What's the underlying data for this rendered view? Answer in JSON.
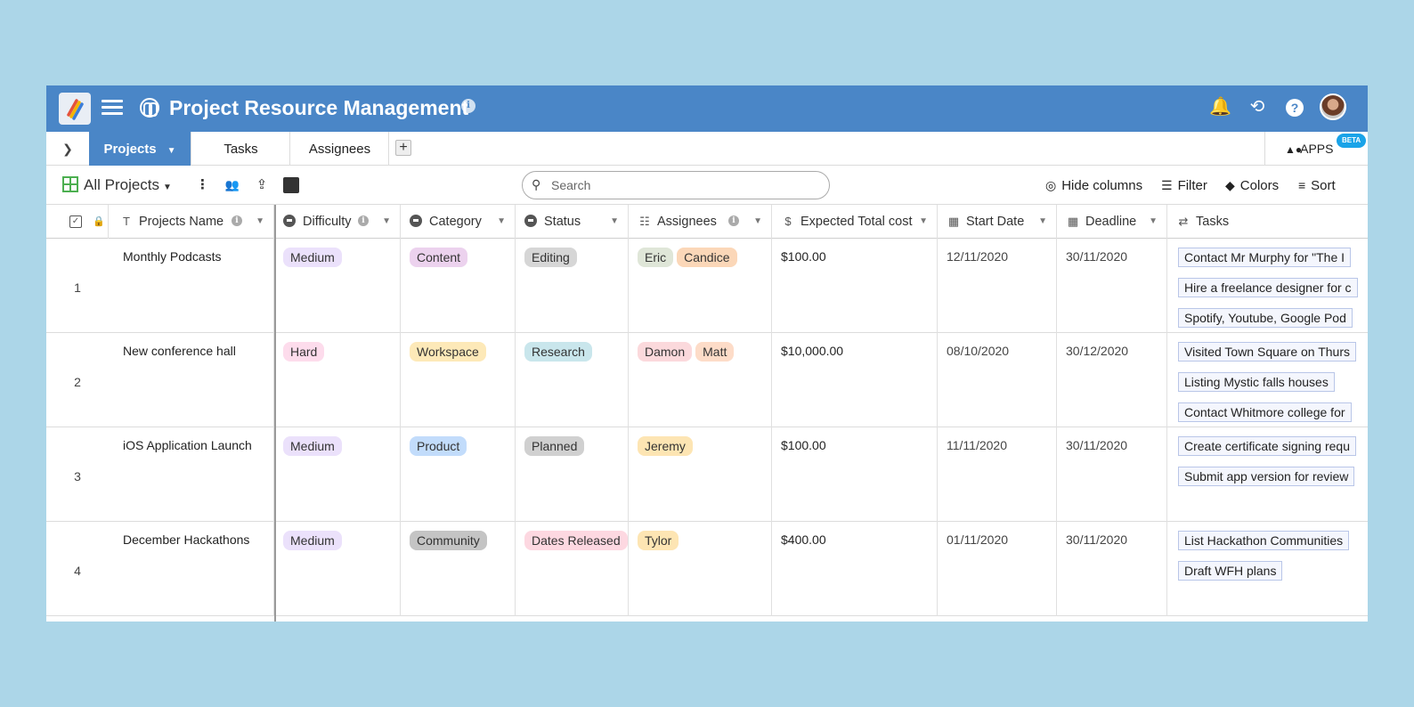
{
  "app": {
    "title": "Project Resource Management",
    "accent": "#4a86c7"
  },
  "tabs": {
    "items": [
      {
        "label": "Projects",
        "active": true
      },
      {
        "label": "Tasks",
        "active": false
      },
      {
        "label": "Assignees",
        "active": false
      }
    ],
    "add_label": "+",
    "apps_label": "APPS",
    "beta_label": "BETA"
  },
  "toolbar": {
    "view_name": "All Projects",
    "search_placeholder": "Search",
    "hide_columns": "Hide columns",
    "filter": "Filter",
    "colors": "Colors",
    "sort": "Sort"
  },
  "columns": {
    "name": "Projects Name",
    "difficulty": "Difficulty",
    "category": "Category",
    "status": "Status",
    "assignees": "Assignees",
    "cost": "Expected Total cost",
    "start": "Start Date",
    "deadline": "Deadline",
    "tasks": "Tasks"
  },
  "pill_colors": {
    "Medium": "#ebe1fb",
    "Hard": "#fddcec",
    "Content": "#ecd2ee",
    "Workspace": "#fde9b8",
    "Product": "#c2dcfb",
    "Community": "#c4c4c4",
    "Editing": "#d6d6d6",
    "Research": "#c9e6ec",
    "Planned": "#d0d0d0",
    "Dates Released": "#fdd8e1",
    "Eric": "#dfe6d8",
    "Candice": "#fbd7b8",
    "Damon": "#fbd9dc",
    "Matt": "#fddcc8",
    "Jeremy": "#fde5b3",
    "Tylor": "#fde5b3"
  },
  "rows": [
    {
      "num": "1",
      "name": "Monthly Podcasts",
      "difficulty": "Medium",
      "category": "Content",
      "status": "Editing",
      "assignees": [
        "Eric",
        "Candice"
      ],
      "cost": "$100.00",
      "start": "12/11/2020",
      "deadline": "30/11/2020",
      "tasks": [
        "Contact Mr Murphy for \"The I",
        "Hire a freelance designer for c",
        "Spotify, Youtube, Google Pod"
      ]
    },
    {
      "num": "2",
      "name": "New conference hall",
      "difficulty": "Hard",
      "category": "Workspace",
      "status": "Research",
      "assignees": [
        "Damon",
        "Matt"
      ],
      "cost": "$10,000.00",
      "start": "08/10/2020",
      "deadline": "30/12/2020",
      "tasks": [
        "Visited Town Square on Thurs",
        "Listing Mystic falls houses",
        "Contact Whitmore college for"
      ]
    },
    {
      "num": "3",
      "name": "iOS Application Launch",
      "difficulty": "Medium",
      "category": "Product",
      "status": "Planned",
      "assignees": [
        "Jeremy"
      ],
      "cost": "$100.00",
      "start": "11/11/2020",
      "deadline": "30/11/2020",
      "tasks": [
        "Create certificate signing requ",
        "Submit app version for review"
      ]
    },
    {
      "num": "4",
      "name": "December Hackathons",
      "difficulty": "Medium",
      "category": "Community",
      "status": "Dates Released",
      "assignees": [
        "Tylor"
      ],
      "cost": "$400.00",
      "start": "01/11/2020",
      "deadline": "30/11/2020",
      "tasks": [
        "List Hackathon Communities",
        "Draft WFH plans"
      ]
    }
  ]
}
